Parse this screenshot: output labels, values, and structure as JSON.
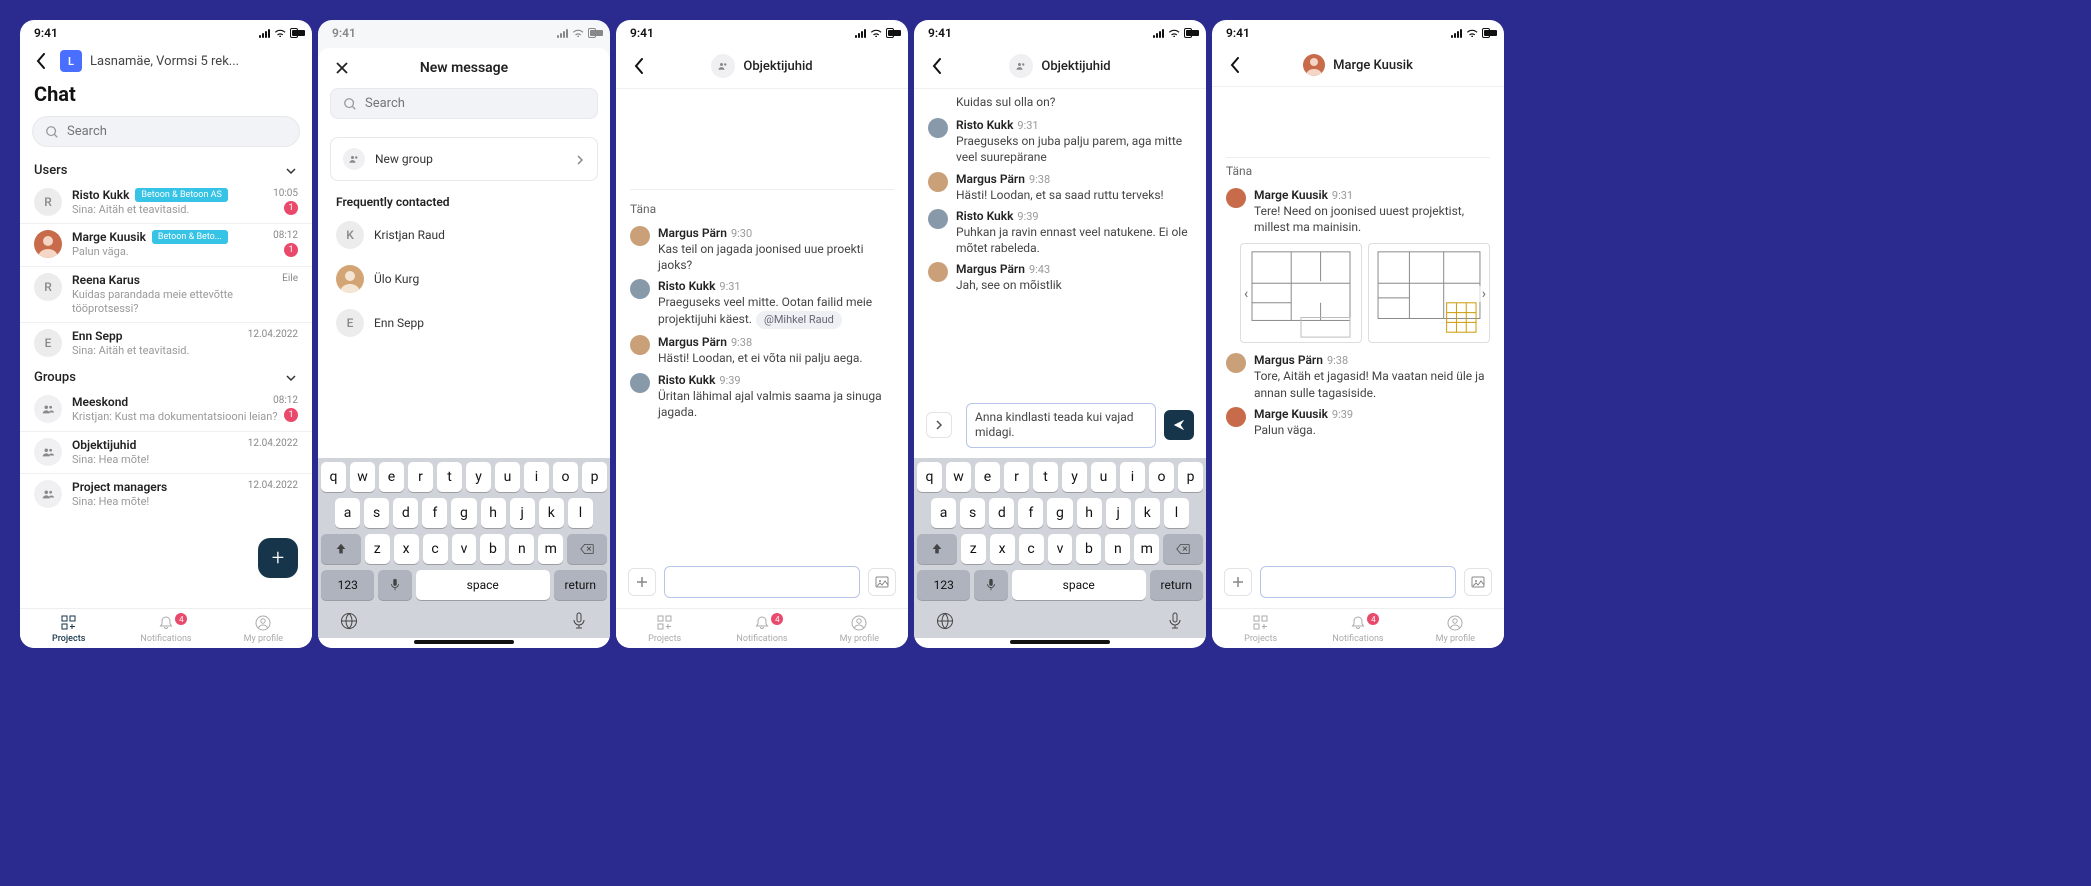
{
  "status_time": "9:41",
  "s1": {
    "breadcrumb": "Lasnamäe, Vormsi 5 rek...",
    "avatar_letter": "L",
    "title": "Chat",
    "search_placeholder": "Search",
    "section_users": "Users",
    "section_groups": "Groups",
    "users": [
      {
        "initial": "R",
        "name": "Risto Kukk",
        "tag": "Betoon & Betoon AS",
        "sub": "Sina: Aitäh et teavitasid.",
        "time": "10:05",
        "badge": "1"
      },
      {
        "initial": "",
        "name": "Marge Kuusik",
        "tag": "Betoon & Beto...",
        "sub": "Palun väga.",
        "time": "08:12",
        "badge": "1",
        "img": true
      },
      {
        "initial": "R",
        "name": "Reena Karus",
        "tag": "",
        "sub": "Kuidas parandada meie ettevõtte tööprotsessi?",
        "time": "Eile",
        "badge": ""
      },
      {
        "initial": "E",
        "name": "Enn Sepp",
        "tag": "",
        "sub": "Sina: Aitäh et teavitasid.",
        "time": "12.04.2022",
        "badge": ""
      }
    ],
    "groups": [
      {
        "name": "Meeskond",
        "sub": "Kristjan: Kust ma dokumentatsiooni leian?",
        "time": "08:12",
        "badge": "1"
      },
      {
        "name": "Objektijuhid",
        "sub": "Sina: Hea mõte!",
        "time": "12.04.2022",
        "badge": ""
      },
      {
        "name": "Project managers",
        "sub": "Sina: Hea mõte!",
        "time": "12.04.2022",
        "badge": ""
      }
    ],
    "tabs": {
      "projects": "Projects",
      "notifications": "Notifications",
      "myprofile": "My profile",
      "notif_badge": "4"
    }
  },
  "s2": {
    "title": "New message",
    "search_placeholder": "Search",
    "new_group": "New group",
    "freq_title": "Frequently contacted",
    "contacts": [
      {
        "initial": "K",
        "name": "Kristjan Raud"
      },
      {
        "initial": "",
        "name": "Ülo Kurg",
        "img": true
      },
      {
        "initial": "E",
        "name": "Enn Sepp"
      }
    ],
    "keys_r1": [
      "q",
      "w",
      "e",
      "r",
      "t",
      "y",
      "u",
      "i",
      "o",
      "p"
    ],
    "keys_r2": [
      "a",
      "s",
      "d",
      "f",
      "g",
      "h",
      "j",
      "k",
      "l"
    ],
    "keys_r3": [
      "z",
      "x",
      "c",
      "v",
      "b",
      "n",
      "m"
    ],
    "key_123": "123",
    "key_space": "space",
    "key_return": "return"
  },
  "s3": {
    "title": "Objektijuhid",
    "day": "Täna",
    "msgs": [
      {
        "name": "Margus Pärn",
        "time": "9:30",
        "text": "Kas teil on jagada joonised uue proekti jaoks?"
      },
      {
        "name": "Risto Kukk",
        "time": "9:31",
        "text": "Praeguseks veel mitte. Ootan failid meie projektijuhi käest.",
        "mention": "@Mihkel Raud"
      },
      {
        "name": "Margus Pärn",
        "time": "9:38",
        "text": "Hästi! Loodan, et ei võta nii palju aega."
      },
      {
        "name": "Risto Kukk",
        "time": "9:39",
        "text": "Üritan lähimal ajal valmis saama ja sinuga jagada."
      }
    ],
    "tabs_badge": "4"
  },
  "s4": {
    "title": "Objektijuhid",
    "line0": "Kuidas sul olla on?",
    "msgs": [
      {
        "name": "Risto Kukk",
        "time": "9:31",
        "text": "Praeguseks on juba palju parem, aga mitte veel suurepärane"
      },
      {
        "name": "Margus Pärn",
        "time": "9:38",
        "text": "Hästi! Loodan, et sa saad ruttu terveks!"
      },
      {
        "name": "Risto Kukk",
        "time": "9:39",
        "text": "Puhkan ja ravin ennast veel natukene. Ei ole mõtet rabeleda."
      },
      {
        "name": "Margus Pärn",
        "time": "9:43",
        "text": "Jah, see on mõistlik"
      }
    ],
    "compose": "Anna kindlasti teada kui vajad midagi.",
    "keys_r1": [
      "q",
      "w",
      "e",
      "r",
      "t",
      "y",
      "u",
      "i",
      "o",
      "p"
    ],
    "keys_r2": [
      "a",
      "s",
      "d",
      "f",
      "g",
      "h",
      "j",
      "k",
      "l"
    ],
    "keys_r3": [
      "z",
      "x",
      "c",
      "v",
      "b",
      "n",
      "m"
    ],
    "key_123": "123",
    "key_space": "space",
    "key_return": "return"
  },
  "s5": {
    "title": "Marge Kuusik",
    "day": "Täna",
    "msgs": [
      {
        "name": "Marge Kuusik",
        "time": "9:31",
        "text": "Tere! Need on joonised uuest projektist, millest ma mainisin."
      },
      {
        "name": "Margus Pärn",
        "time": "9:38",
        "text": "Tore, Aitäh et jagasid! Ma vaatan neid üle ja annan sulle tagasiside."
      },
      {
        "name": "Marge Kuusik",
        "time": "9:39",
        "text": "Palun väga."
      }
    ],
    "tabs_badge": "4"
  },
  "tabs": {
    "projects": "Projects",
    "notifications": "Notifications",
    "myprofile": "My profile"
  }
}
